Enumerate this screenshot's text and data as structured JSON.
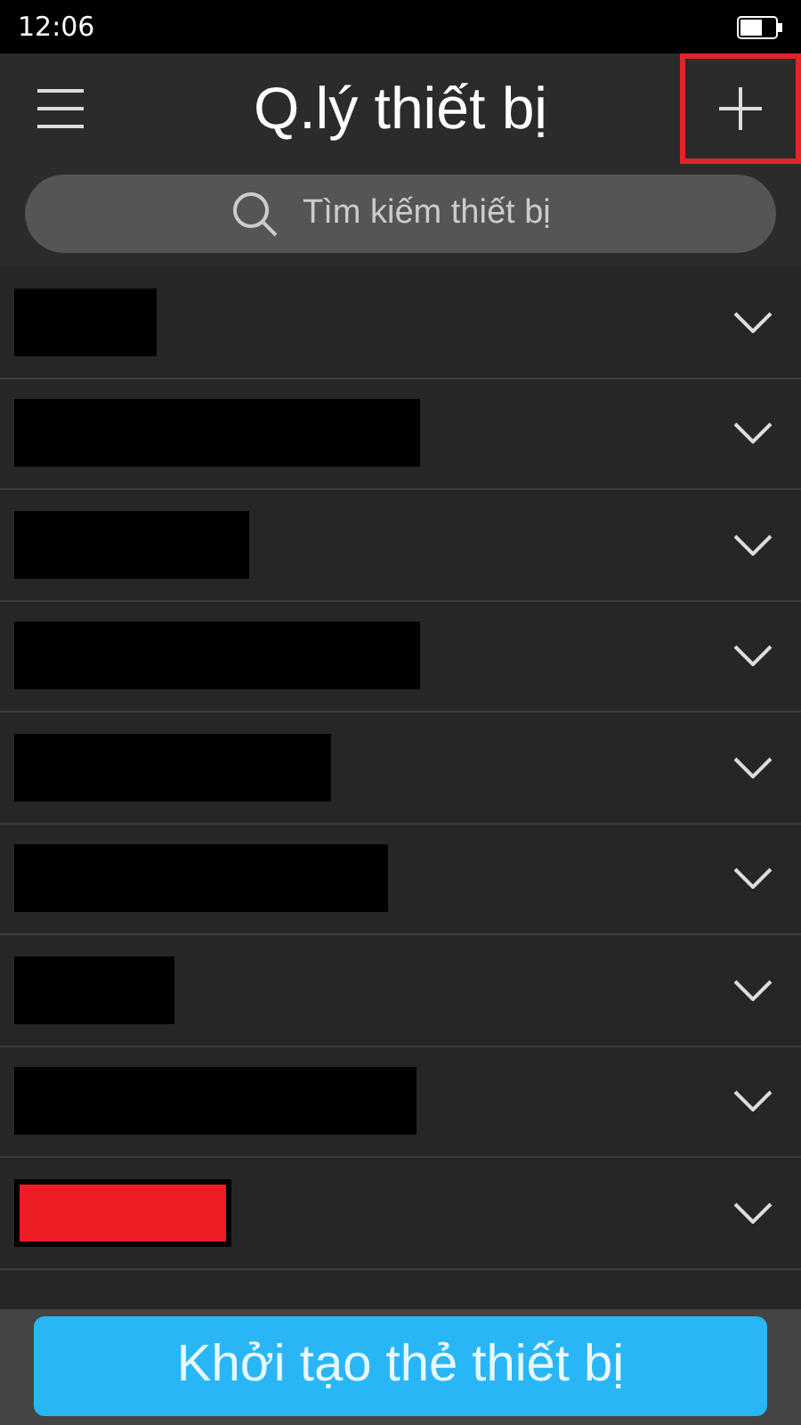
{
  "status_bar": {
    "time": "12:06"
  },
  "header": {
    "title": "Q.lý thiết bị",
    "add_highlighted": true
  },
  "search": {
    "placeholder": "Tìm kiếm thiết bị"
  },
  "devices": [
    {
      "expanded": false,
      "color": "#000000"
    },
    {
      "expanded": false,
      "color": "#000000"
    },
    {
      "expanded": false,
      "color": "#000000"
    },
    {
      "expanded": false,
      "color": "#000000"
    },
    {
      "expanded": false,
      "color": "#000000"
    },
    {
      "expanded": false,
      "color": "#000000"
    },
    {
      "expanded": false,
      "color": "#000000"
    },
    {
      "expanded": false,
      "color": "#000000"
    },
    {
      "expanded": false,
      "color": "#ee1c25"
    }
  ],
  "action_button": "Khởi tạo thẻ thiết bị"
}
